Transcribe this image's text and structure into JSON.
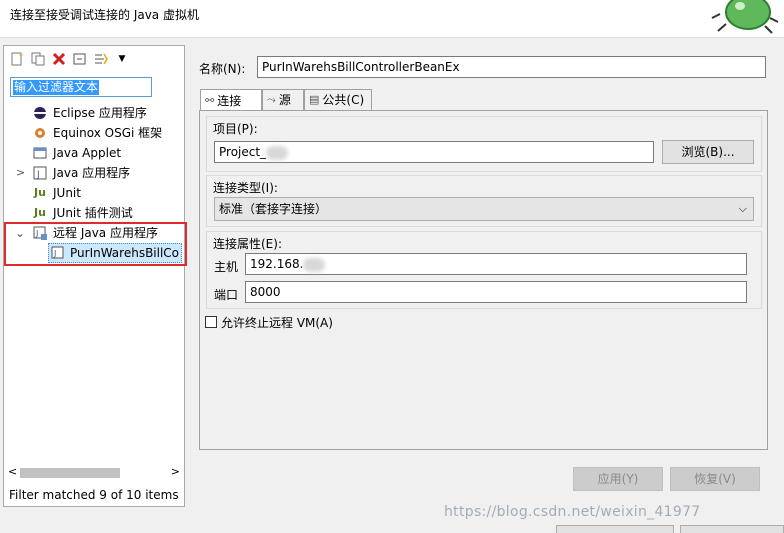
{
  "header": {
    "title": "连接至接受调试连接的 Java 虚拟机"
  },
  "left": {
    "filter_text": "输入过滤器文本",
    "tree": [
      {
        "label": "Eclipse 应用程序",
        "icon": "eclipse-icon"
      },
      {
        "label": "Equinox OSGi 框架",
        "icon": "osgi-icon"
      },
      {
        "label": "Java Applet",
        "icon": "applet-icon"
      },
      {
        "label": "Java 应用程序",
        "icon": "java-app-icon"
      },
      {
        "label": "JUnit",
        "icon": "junit-icon"
      },
      {
        "label": "JUnit 插件测试",
        "icon": "junit-plugin-icon"
      },
      {
        "label": "远程 Java 应用程序",
        "icon": "remote-java-icon"
      },
      {
        "label": "PurInWarehsBillCo",
        "icon": "config-icon"
      }
    ],
    "status": "Filter matched 9 of 10 items"
  },
  "form": {
    "name_label": "名称(N):",
    "name_value": "PurInWarehsBillControllerBeanEx",
    "tabs": [
      "连接",
      "源",
      "公共(C)"
    ],
    "project_group": "项目(P):",
    "project_value": "Project_",
    "browse_label": "浏览(B)...",
    "conn_type_group": "连接类型(I):",
    "conn_type_value": "标准（套接字连接）",
    "conn_props_group": "连接属性(E):",
    "host_label": "主机",
    "host_value": "192.168.",
    "port_label": "端口",
    "port_value": "8000",
    "allow_terminate": "允许终止远程 VM(A)",
    "apply_label": "应用(Y)",
    "revert_label": "恢复(V)"
  },
  "watermark": "https://blog.csdn.net/weixin_41977"
}
